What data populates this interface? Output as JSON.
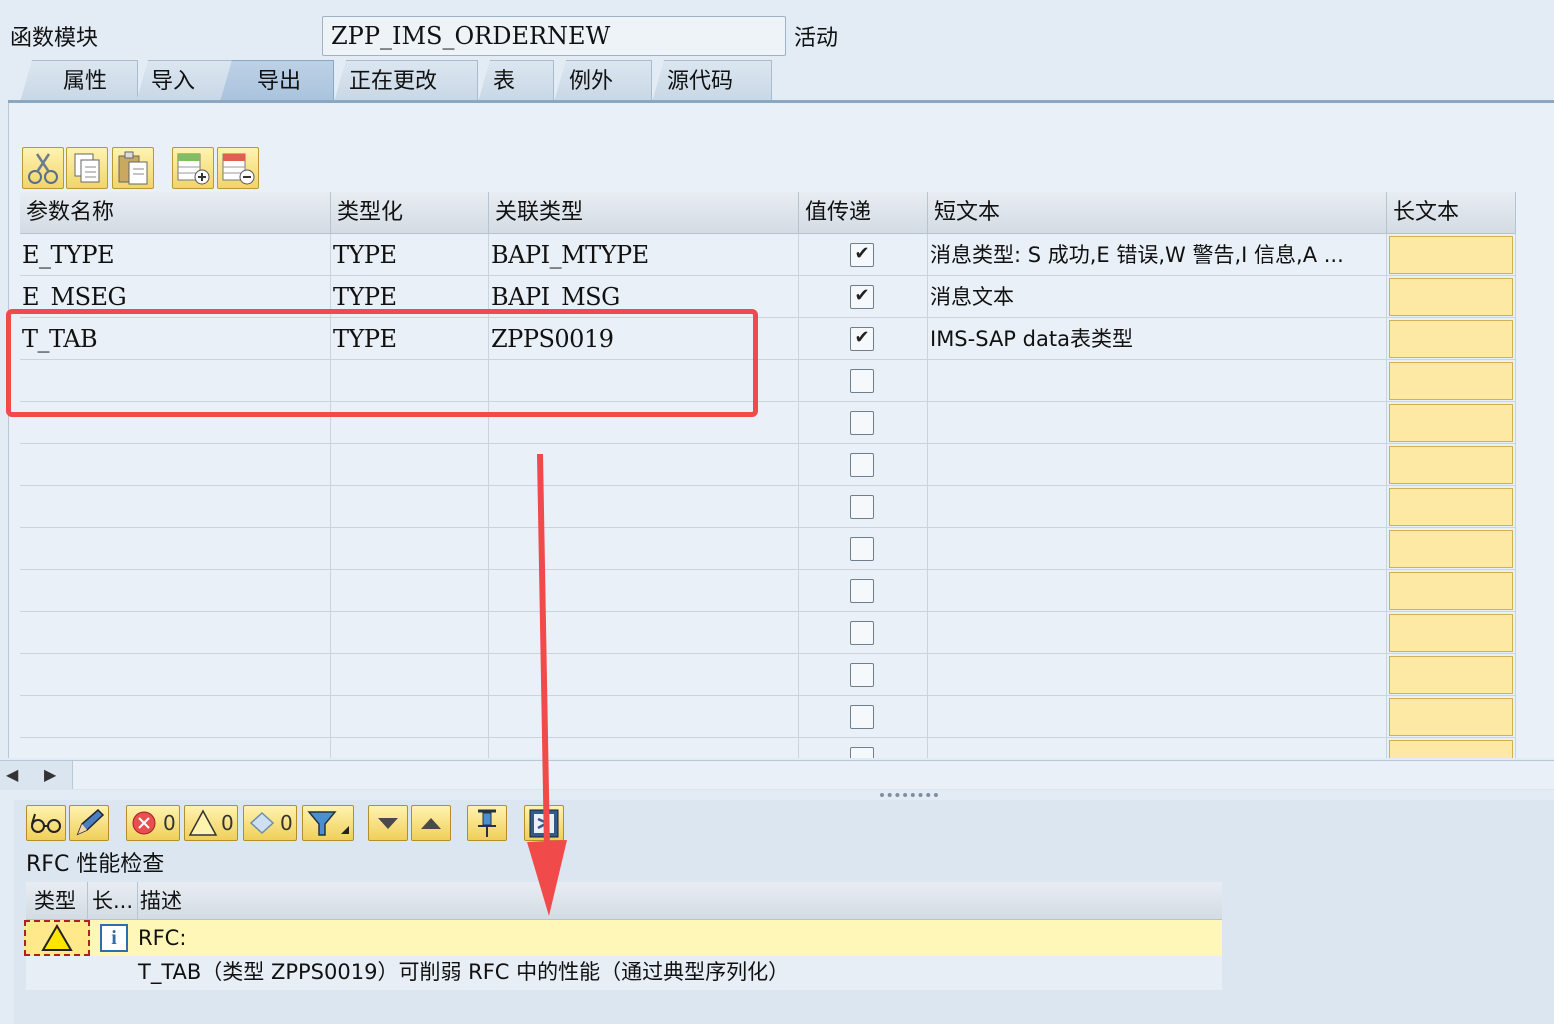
{
  "header": {
    "label": "函数模块",
    "function_name": "ZPP_IMS_ORDERNEW",
    "status": "活动"
  },
  "tabs": [
    {
      "label": "属性"
    },
    {
      "label": "导入"
    },
    {
      "label": "导出"
    },
    {
      "label": "正在更改"
    },
    {
      "label": "表"
    },
    {
      "label": "例外"
    },
    {
      "label": "源代码"
    }
  ],
  "toolbar": {
    "icons": [
      "cut-icon",
      "copy-icon",
      "paste-icon",
      "insert-row-icon",
      "delete-row-icon"
    ]
  },
  "table": {
    "columns": [
      "参数名称",
      "类型化",
      "关联类型",
      "值传递",
      "短文本",
      "长文本"
    ],
    "rows": [
      {
        "name": "E_TYPE",
        "typing": "TYPE",
        "ref_type": "BAPI_MTYPE",
        "checked": true,
        "short_text": "消息类型: S 成功,E 错误,W 警告,I 信息,A ..."
      },
      {
        "name": "E_MSEG",
        "typing": "TYPE",
        "ref_type": "BAPI_MSG",
        "checked": true,
        "short_text": "消息文本"
      },
      {
        "name": "T_TAB",
        "typing": "TYPE",
        "ref_type": "ZPPS0019",
        "checked": true,
        "short_text": "IMS-SAP data表类型"
      },
      {
        "name": "",
        "typing": "",
        "ref_type": "",
        "checked": false,
        "short_text": ""
      },
      {
        "name": "",
        "typing": "",
        "ref_type": "",
        "checked": false,
        "short_text": ""
      },
      {
        "name": "",
        "typing": "",
        "ref_type": "",
        "checked": false,
        "short_text": ""
      },
      {
        "name": "",
        "typing": "",
        "ref_type": "",
        "checked": false,
        "short_text": ""
      },
      {
        "name": "",
        "typing": "",
        "ref_type": "",
        "checked": false,
        "short_text": ""
      },
      {
        "name": "",
        "typing": "",
        "ref_type": "",
        "checked": false,
        "short_text": ""
      },
      {
        "name": "",
        "typing": "",
        "ref_type": "",
        "checked": false,
        "short_text": ""
      },
      {
        "name": "",
        "typing": "",
        "ref_type": "",
        "checked": false,
        "short_text": ""
      },
      {
        "name": "",
        "typing": "",
        "ref_type": "",
        "checked": false,
        "short_text": ""
      },
      {
        "name": "",
        "typing": "",
        "ref_type": "",
        "checked": false,
        "short_text": ""
      }
    ]
  },
  "log_toolbar": {
    "error_count": "0",
    "warning_count": "0",
    "info_count": "0"
  },
  "log": {
    "title": "RFC 性能检查",
    "columns": [
      "类型",
      "长...",
      "描述"
    ],
    "entries": [
      {
        "line1": "RFC:",
        "line2": "T_TAB（类型 ZPPS0019）可削弱 RFC 中的性能（通过典型序列化）"
      }
    ]
  },
  "colors": {
    "highlight_red": "#f04a4a",
    "toolbar_yellow": "#f0d56a",
    "long_text_cell": "#fde9a3",
    "log_warning_row": "#fff7b8"
  }
}
